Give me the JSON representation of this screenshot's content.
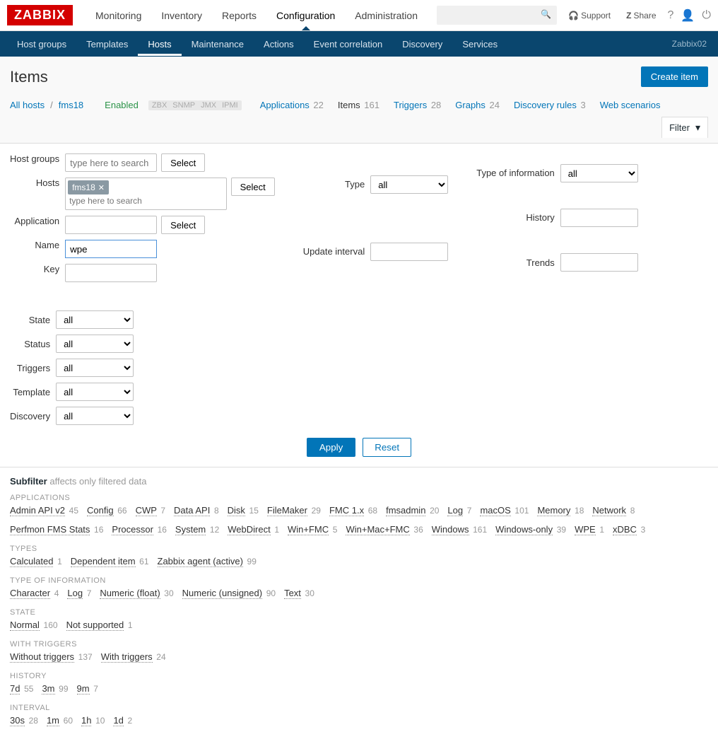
{
  "brand": "ZABBIX",
  "topnav": [
    "Monitoring",
    "Inventory",
    "Reports",
    "Configuration",
    "Administration"
  ],
  "topnav_active": 3,
  "topright": {
    "support": "Support",
    "share": "Share",
    "help": "?",
    "user": "👤",
    "power": "⏻"
  },
  "search_placeholder": "",
  "subnav": [
    "Host groups",
    "Templates",
    "Hosts",
    "Maintenance",
    "Actions",
    "Event correlation",
    "Discovery",
    "Services"
  ],
  "subnav_active": 2,
  "server_name": "Zabbix02",
  "page_title": "Items",
  "create_btn": "Create item",
  "crumb": {
    "all_hosts": "All hosts",
    "host": "fms18",
    "enabled": "Enabled",
    "pills": [
      "ZBX",
      "SNMP",
      "JMX",
      "IPMI"
    ],
    "tabs": [
      {
        "label": "Applications",
        "count": 22
      },
      {
        "label": "Items",
        "count": 161,
        "active": true
      },
      {
        "label": "Triggers",
        "count": 28
      },
      {
        "label": "Graphs",
        "count": 24
      },
      {
        "label": "Discovery rules",
        "count": 3
      },
      {
        "label": "Web scenarios",
        "count": ""
      }
    ],
    "filter_label": "Filter"
  },
  "filter": {
    "labels": {
      "host_groups": "Host groups",
      "hosts": "Hosts",
      "application": "Application",
      "name": "Name",
      "key": "Key",
      "type": "Type",
      "update_interval": "Update interval",
      "type_info": "Type of information",
      "history": "History",
      "trends": "Trends",
      "state": "State",
      "status": "Status",
      "triggers": "Triggers",
      "template": "Template",
      "discovery": "Discovery"
    },
    "host_groups_placeholder": "type here to search",
    "host_chip": "fms18",
    "hosts_placeholder": "type here to search",
    "name_value": "wpe",
    "select_btn": "Select",
    "all_option": "all",
    "apply": "Apply",
    "reset": "Reset"
  },
  "subfilter": {
    "title": "Subfilter",
    "note": "affects only filtered data",
    "groups": [
      {
        "heading": "APPLICATIONS",
        "items": [
          {
            "l": "Admin API v2",
            "c": 45
          },
          {
            "l": "Config",
            "c": 66
          },
          {
            "l": "CWP",
            "c": 7
          },
          {
            "l": "Data API",
            "c": 8
          },
          {
            "l": "Disk",
            "c": 15
          },
          {
            "l": "FileMaker",
            "c": 29
          },
          {
            "l": "FMC 1.x",
            "c": 68
          },
          {
            "l": "fmsadmin",
            "c": 20
          },
          {
            "l": "Log",
            "c": 7
          },
          {
            "l": "macOS",
            "c": 101
          },
          {
            "l": "Memory",
            "c": 18
          },
          {
            "l": "Network",
            "c": 8
          },
          {
            "l": "Perfmon FMS Stats",
            "c": 16
          },
          {
            "l": "Processor",
            "c": 16
          },
          {
            "l": "System",
            "c": 12
          },
          {
            "l": "WebDirect",
            "c": 1
          },
          {
            "l": "Win+FMC",
            "c": 5
          },
          {
            "l": "Win+Mac+FMC",
            "c": 36
          },
          {
            "l": "Windows",
            "c": 161
          },
          {
            "l": "Windows-only",
            "c": 39
          },
          {
            "l": "WPE",
            "c": 1
          },
          {
            "l": "xDBC",
            "c": 3
          }
        ]
      },
      {
        "heading": "TYPES",
        "items": [
          {
            "l": "Calculated",
            "c": 1
          },
          {
            "l": "Dependent item",
            "c": 61
          },
          {
            "l": "Zabbix agent (active)",
            "c": 99
          }
        ]
      },
      {
        "heading": "TYPE OF INFORMATION",
        "items": [
          {
            "l": "Character",
            "c": 4
          },
          {
            "l": "Log",
            "c": 7
          },
          {
            "l": "Numeric (float)",
            "c": 30
          },
          {
            "l": "Numeric (unsigned)",
            "c": 90
          },
          {
            "l": "Text",
            "c": 30
          }
        ]
      },
      {
        "heading": "STATE",
        "items": [
          {
            "l": "Normal",
            "c": 160
          },
          {
            "l": "Not supported",
            "c": 1
          }
        ]
      },
      {
        "heading": "WITH TRIGGERS",
        "items": [
          {
            "l": "Without triggers",
            "c": 137
          },
          {
            "l": "With triggers",
            "c": 24
          }
        ]
      },
      {
        "heading": "HISTORY",
        "items": [
          {
            "l": "7d",
            "c": 55
          },
          {
            "l": "3m",
            "c": 99
          },
          {
            "l": "9m",
            "c": 7
          }
        ]
      },
      {
        "heading": "INTERVAL",
        "items": [
          {
            "l": "30s",
            "c": 28
          },
          {
            "l": "1m",
            "c": 60
          },
          {
            "l": "1h",
            "c": 10
          },
          {
            "l": "1d",
            "c": 2
          }
        ]
      }
    ]
  }
}
